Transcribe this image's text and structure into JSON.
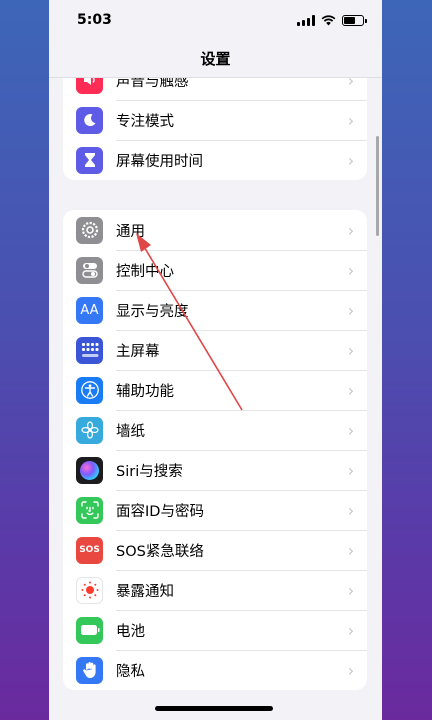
{
  "status_bar": {
    "time": "5:03"
  },
  "nav": {
    "title": "设置"
  },
  "group1": [
    {
      "label": "声音与触感",
      "icon": "speaker-icon",
      "color": "#ff2d55"
    },
    {
      "label": "专注模式",
      "icon": "moon-icon",
      "color": "#5e5ce6"
    },
    {
      "label": "屏幕使用时间",
      "icon": "hourglass-icon",
      "color": "#5e5ce6"
    }
  ],
  "group2": [
    {
      "label": "通用",
      "icon": "gear-icon",
      "color": "#8e8e93"
    },
    {
      "label": "控制中心",
      "icon": "toggles-icon",
      "color": "#8e8e93"
    },
    {
      "label": "显示与亮度",
      "icon": "aa-icon",
      "glyph": "AA",
      "color": "#3478f6"
    },
    {
      "label": "主屏幕",
      "icon": "grid-icon",
      "color": "#3a56d6"
    },
    {
      "label": "辅助功能",
      "icon": "accessibility-icon",
      "color": "#1a7cf5"
    },
    {
      "label": "墙纸",
      "icon": "flower-icon",
      "color": "#36aadc"
    },
    {
      "label": "Siri与搜索",
      "icon": "siri-icon",
      "color": "#1c1c1e"
    },
    {
      "label": "面容ID与密码",
      "icon": "faceid-icon",
      "color": "#34c759"
    },
    {
      "label": "SOS紧急联络",
      "icon": "sos-icon",
      "glyph": "SOS",
      "color": "#e8483f"
    },
    {
      "label": "暴露通知",
      "icon": "exposure-icon",
      "color": "#ffffff"
    },
    {
      "label": "电池",
      "icon": "battery-icon",
      "color": "#34c759"
    },
    {
      "label": "隐私",
      "icon": "hand-icon",
      "color": "#3478f6"
    }
  ]
}
